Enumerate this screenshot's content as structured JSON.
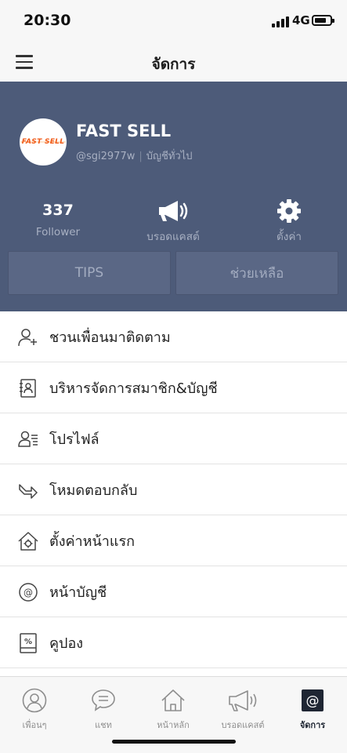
{
  "status_bar": {
    "time": "20:30",
    "network": "4G"
  },
  "nav": {
    "title": "จัดการ"
  },
  "profile": {
    "logo_text": "FAST SELL",
    "name": "FAST SELL",
    "handle": "@sgi2977w",
    "account_type": "บัญชีทั่วไป",
    "stats": [
      {
        "value": "337",
        "label": "Follower"
      },
      {
        "icon": "megaphone-icon",
        "label": "บรอดแคสต์"
      },
      {
        "icon": "gear-icon",
        "label": "ตั้งค่า"
      }
    ],
    "buttons": {
      "tips": "TIPS",
      "help": "ช่วยเหลือ"
    }
  },
  "menu": [
    {
      "icon": "add-friend-icon",
      "label": "ชวนเพื่อนมาติดตาม"
    },
    {
      "icon": "contact-book-icon",
      "label": "บริหารจัดการสมาชิก&บัญชี"
    },
    {
      "icon": "profile-card-icon",
      "label": "โปรไฟล์"
    },
    {
      "icon": "reply-arrow-icon",
      "label": "โหมดตอบกลับ"
    },
    {
      "icon": "home-gear-icon",
      "label": "ตั้งค่าหน้าแรก"
    },
    {
      "icon": "at-sign-icon",
      "label": "หน้าบัญชี"
    },
    {
      "icon": "coupon-icon",
      "label": "คูปอง"
    }
  ],
  "tabs": [
    {
      "icon": "friends-icon",
      "label": "เพื่อนๆ"
    },
    {
      "icon": "chat-icon",
      "label": "แชท"
    },
    {
      "icon": "home-icon",
      "label": "หน้าหลัก"
    },
    {
      "icon": "broadcast-icon",
      "label": "บรอดแคสต์"
    },
    {
      "icon": "manage-icon",
      "label": "จัดการ",
      "active": true
    }
  ],
  "colors": {
    "header_bg": "#4d5b79",
    "accent_dark": "#1f2633",
    "tab_inactive": "#8e8e8e"
  }
}
